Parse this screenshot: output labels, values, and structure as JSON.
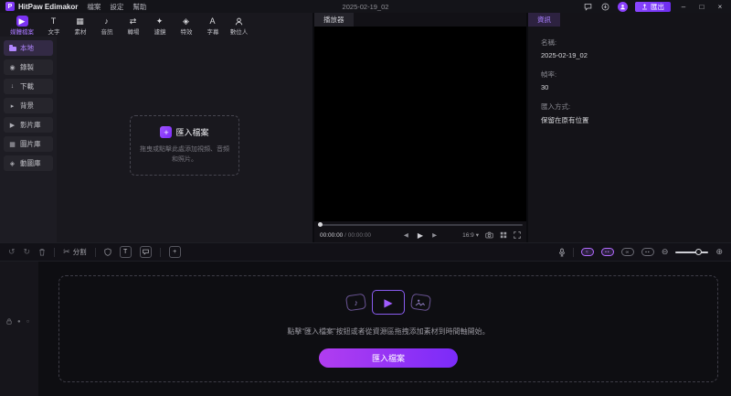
{
  "window": {
    "app_name": "HitPaw Edimakor",
    "menus": [
      "檔案",
      "設定",
      "幫助"
    ],
    "document_title": "2025-02-19_02",
    "export_label": "匯出"
  },
  "ribbon": {
    "tabs": [
      {
        "label": "媒體檔案",
        "icon": "media-files-icon",
        "active": true
      },
      {
        "label": "文字",
        "icon": "text-icon",
        "active": false
      },
      {
        "label": "素材",
        "icon": "stickers-icon",
        "active": false
      },
      {
        "label": "音訊",
        "icon": "audio-icon",
        "active": false
      },
      {
        "label": "轉場",
        "icon": "transitions-icon",
        "active": false
      },
      {
        "label": "濾鏡",
        "icon": "filters-icon",
        "active": false
      },
      {
        "label": "特效",
        "icon": "effects-icon",
        "active": false
      },
      {
        "label": "字幕",
        "icon": "subtitles-icon",
        "active": false
      },
      {
        "label": "數位人",
        "icon": "digital-human-icon",
        "active": false
      }
    ]
  },
  "sidebar": {
    "items": [
      {
        "label": "本地",
        "active": true
      },
      {
        "label": "錄製",
        "active": false
      },
      {
        "label": "下載",
        "active": false
      },
      {
        "label": "背景",
        "active": false
      },
      {
        "label": "影片庫",
        "active": false
      },
      {
        "label": "圖片庫",
        "active": false
      },
      {
        "label": "動圖庫",
        "active": false
      }
    ]
  },
  "media_panel": {
    "import_title": "匯入檔案",
    "import_hint": "拖曳或點擊此處添加視頻、音頻和照片。"
  },
  "player": {
    "tab_label": "播放器",
    "current_time": "00:00:00",
    "time_separator": "/",
    "total_time": "00:00:00",
    "aspect_ratio": "16:9"
  },
  "info_panel": {
    "tab_label": "資訊",
    "fields": [
      {
        "label": "名稱:",
        "value": "2025-02-19_02"
      },
      {
        "label": "幀率:",
        "value": "30"
      },
      {
        "label": "匯入方式:",
        "value": "保留在原有位置"
      }
    ]
  },
  "timeline_toolbar": {
    "split_label": "分割"
  },
  "timeline": {
    "empty_hint": "點擊“匯入檔案”按鈕或者從資源區拖拽添加素材到時間軸開始。",
    "import_button_label": "匯入檔案"
  },
  "colors": {
    "accent": "#8a3ffc",
    "accent_gradient_start": "#b13df0",
    "accent_gradient_end": "#7b2bf9",
    "panel_background": "#19181e",
    "video_background": "#000000"
  }
}
